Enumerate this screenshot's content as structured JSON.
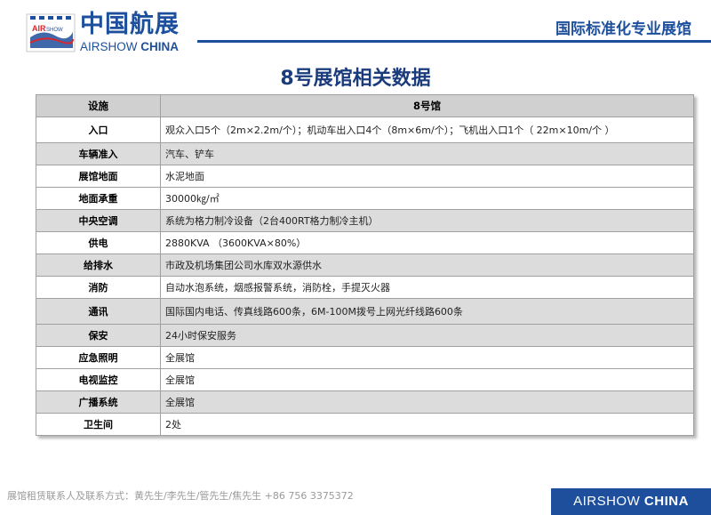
{
  "header": {
    "logo_mark_text": "AIRSHOW CHINA",
    "logo_cn": "中国航展",
    "logo_en_light": "AIRSHOW",
    "logo_en_bold": "CHINA",
    "tagline": "国际标准化专业展馆"
  },
  "page_title": "8号展馆相关数据",
  "table": {
    "headers": [
      "设施",
      "8号馆"
    ],
    "rows": [
      {
        "label": "入口",
        "value": "观众入口5个（2m×2.2m/个）；机动车出入口4个（8m×6m/个）；飞机出入口1个（ 22m×10m/个 ）"
      },
      {
        "label": "车辆准入",
        "value": "汽车、铲车"
      },
      {
        "label": "展馆地面",
        "value": "水泥地面"
      },
      {
        "label": "地面承重",
        "value": "30000㎏/㎡"
      },
      {
        "label": "中央空调",
        "value": "系统为格力制冷设备（2台400RT格力制冷主机）"
      },
      {
        "label": "供电",
        "value": "2880KVA （3600KVA×80%）"
      },
      {
        "label": "给排水",
        "value": "市政及机场集团公司水库双水源供水"
      },
      {
        "label": "消防",
        "value": "自动水泡系统，烟感报警系统，消防栓，手提灭火器"
      },
      {
        "label": "通讯",
        "value": "国际国内电话、传真线路600条，6M-100M拨号上网光纤线路600条"
      },
      {
        "label": "保安",
        "value": "24小时保安服务"
      },
      {
        "label": "应急照明",
        "value": "全展馆"
      },
      {
        "label": "电视监控",
        "value": "全展馆"
      },
      {
        "label": "广播系统",
        "value": "全展馆"
      },
      {
        "label": "卫生间",
        "value": "2处"
      }
    ]
  },
  "footer": {
    "contact": "展馆租赁联系人及联系方式：黄先生/李先生/管先生/焦先生    +86 756 3375372",
    "brand_light": "AIRSHOW",
    "brand_bold": "CHINA"
  },
  "colors": {
    "brand_blue": "#1d4f9c",
    "title_blue": "#1a3b7c",
    "row_shade": "#dcdcdc",
    "header_fill": "#d0d0d0"
  }
}
